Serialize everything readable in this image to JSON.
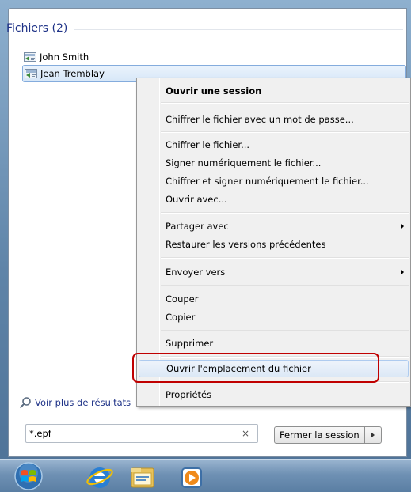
{
  "results": {
    "section_title": "Fichiers (2)",
    "items": [
      {
        "label": "John Smith",
        "icon": "certificate-file-icon"
      },
      {
        "label": "Jean Tremblay",
        "icon": "certificate-file-icon"
      }
    ],
    "see_more": "Voir plus de résultats"
  },
  "search": {
    "value": "*.epf",
    "clear_icon": "×"
  },
  "shutdown": {
    "label": "Fermer la session",
    "arrow_icon": "chevron-right-icon"
  },
  "context_menu": {
    "items": {
      "open_session": "Ouvrir une session",
      "encrypt_with_password": "Chiffrer le fichier avec un mot de passe...",
      "encrypt_file": "Chiffrer le fichier...",
      "sign_file": "Signer numériquement le fichier...",
      "encrypt_and_sign": "Chiffrer et signer numériquement le fichier...",
      "open_with": "Ouvrir avec...",
      "share_with": "Partager avec",
      "restore_versions": "Restaurer les versions précédentes",
      "send_to": "Envoyer vers",
      "cut": "Couper",
      "copy": "Copier",
      "delete": "Supprimer",
      "open_file_location": "Ouvrir l'emplacement du fichier",
      "properties": "Propriétés"
    }
  },
  "taskbar": {
    "icons": [
      "windows-start-orb",
      "internet-explorer-icon",
      "windows-explorer-icon",
      "windows-media-player-icon"
    ]
  },
  "colors": {
    "link_blue": "#1e3287",
    "highlight_red": "#c00000",
    "selection_blue": "#84acdd"
  }
}
